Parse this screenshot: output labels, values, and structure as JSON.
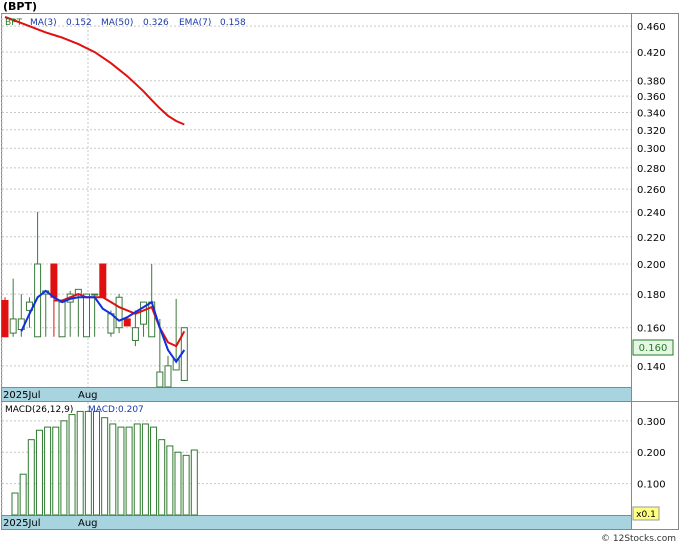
{
  "header": {
    "ticker": "(BPT)",
    "legend_symbol": "BPT",
    "ma3_label": "MA(3)",
    "ma3_value": "0.152",
    "ma50_label": "MA(50)",
    "ma50_value": "0.326",
    "ema7_label": "EMA(7)",
    "ema7_value": "0.158"
  },
  "price_panel": {
    "last_price_badge": "0.160",
    "x_ticks": [
      "2025Jul",
      "Aug"
    ],
    "y_ticks": [
      "0.460",
      "0.420",
      "0.380",
      "0.360",
      "0.340",
      "0.320",
      "0.300",
      "0.280",
      "0.260",
      "0.240",
      "0.220",
      "0.200",
      "0.180",
      "0.160",
      "0.140"
    ]
  },
  "macd_panel": {
    "label": "MACD(26,12,9)",
    "value_label": "MACD:0.207",
    "y_ticks": [
      "0.300",
      "0.200",
      "0.100"
    ],
    "scale_badge": "x0.1",
    "x_ticks": [
      "2025Jul",
      "Aug"
    ]
  },
  "watermark": "© 12Stocks.com",
  "colors": {
    "up_candle": "#3a7a3a",
    "down_candle": "#e01010",
    "ma3": "#1030e0",
    "ma50": "#e01010",
    "ema7": "#e01010",
    "macd_bar": "#2f7a2f",
    "axis_band": "#a8d4e0",
    "grid": "#c8c8c8",
    "badge_fill": "#e4f6e4",
    "badge_text": "#2a7a2a",
    "header_text": "#1a3aa8",
    "symbol_text": "#2a7a2a"
  },
  "chart_data": [
    {
      "type": "candlestick",
      "title": "(BPT)",
      "x_tick_labels": [
        "2025Jul",
        "Aug"
      ],
      "ylim": [
        0.13,
        0.48
      ],
      "y_scale": "log",
      "grid": true,
      "candles": [
        {
          "o": 0.176,
          "h": 0.178,
          "l": 0.155,
          "c": 0.155
        },
        {
          "o": 0.157,
          "h": 0.19,
          "l": 0.155,
          "c": 0.165
        },
        {
          "o": 0.159,
          "h": 0.18,
          "l": 0.155,
          "c": 0.165
        },
        {
          "o": 0.17,
          "h": 0.178,
          "l": 0.16,
          "c": 0.175
        },
        {
          "o": 0.155,
          "h": 0.24,
          "l": 0.155,
          "c": 0.2
        },
        {
          "o": 0.18,
          "h": 0.182,
          "l": 0.155,
          "c": 0.182
        },
        {
          "o": 0.2,
          "h": 0.2,
          "l": 0.155,
          "c": 0.178
        },
        {
          "o": 0.155,
          "h": 0.175,
          "l": 0.155,
          "c": 0.175
        },
        {
          "o": 0.175,
          "h": 0.182,
          "l": 0.155,
          "c": 0.18
        },
        {
          "o": 0.18,
          "h": 0.182,
          "l": 0.155,
          "c": 0.183
        },
        {
          "o": 0.155,
          "h": 0.18,
          "l": 0.155,
          "c": 0.18
        },
        {
          "o": 0.18,
          "h": 0.18,
          "l": 0.155,
          "c": 0.18
        },
        {
          "o": 0.2,
          "h": 0.2,
          "l": 0.178,
          "c": 0.178
        },
        {
          "o": 0.157,
          "h": 0.17,
          "l": 0.155,
          "c": 0.168
        },
        {
          "o": 0.16,
          "h": 0.18,
          "l": 0.157,
          "c": 0.178
        },
        {
          "o": 0.165,
          "h": 0.165,
          "l": 0.161,
          "c": 0.161
        },
        {
          "o": 0.153,
          "h": 0.17,
          "l": 0.15,
          "c": 0.16
        },
        {
          "o": 0.162,
          "h": 0.175,
          "l": 0.155,
          "c": 0.175
        },
        {
          "o": 0.155,
          "h": 0.2,
          "l": 0.155,
          "c": 0.175
        },
        {
          "o": 0.13,
          "h": 0.165,
          "l": 0.13,
          "c": 0.137
        },
        {
          "o": 0.13,
          "h": 0.145,
          "l": 0.13,
          "c": 0.14
        },
        {
          "o": 0.138,
          "h": 0.177,
          "l": 0.138,
          "c": 0.143
        },
        {
          "o": 0.133,
          "h": 0.16,
          "l": 0.133,
          "c": 0.16
        }
      ],
      "series": [
        {
          "name": "MA(3)",
          "values": [
            null,
            null,
            0.158,
            0.168,
            0.178,
            0.182,
            0.178,
            0.175,
            0.177,
            0.178,
            0.178,
            0.178,
            0.171,
            0.168,
            0.164,
            0.166,
            0.169,
            0.172,
            0.175,
            0.16,
            0.148,
            0.142,
            0.148
          ]
        },
        {
          "name": "EMA(7)",
          "values": [
            null,
            null,
            null,
            null,
            null,
            null,
            0.176,
            0.176,
            0.178,
            0.18,
            0.178,
            0.178,
            0.178,
            0.175,
            0.172,
            0.17,
            0.168,
            0.17,
            0.172,
            0.16,
            0.152,
            0.15,
            0.158
          ]
        },
        {
          "name": "MA(50)",
          "x_start": 0,
          "x_end": 22,
          "values": [
            0.475,
            0.47,
            0.465,
            0.46,
            0.455,
            0.45,
            0.446,
            0.442,
            0.437,
            0.432,
            0.426,
            0.42,
            0.412,
            0.404,
            0.395,
            0.386,
            0.376,
            0.366,
            0.355,
            0.345,
            0.336,
            0.33,
            0.326
          ]
        }
      ]
    },
    {
      "type": "bar",
      "title": "MACD(26,12,9)",
      "x_tick_labels": [
        "2025Jul",
        "Aug"
      ],
      "ylim": [
        0.0,
        0.36
      ],
      "grid": true,
      "series": [
        {
          "name": "MACD",
          "values": [
            0.07,
            0.13,
            0.24,
            0.27,
            0.28,
            0.28,
            0.3,
            0.32,
            0.33,
            0.33,
            0.33,
            0.31,
            0.29,
            0.28,
            0.28,
            0.29,
            0.29,
            0.28,
            0.24,
            0.22,
            0.2,
            0.19,
            0.207
          ]
        }
      ]
    }
  ]
}
